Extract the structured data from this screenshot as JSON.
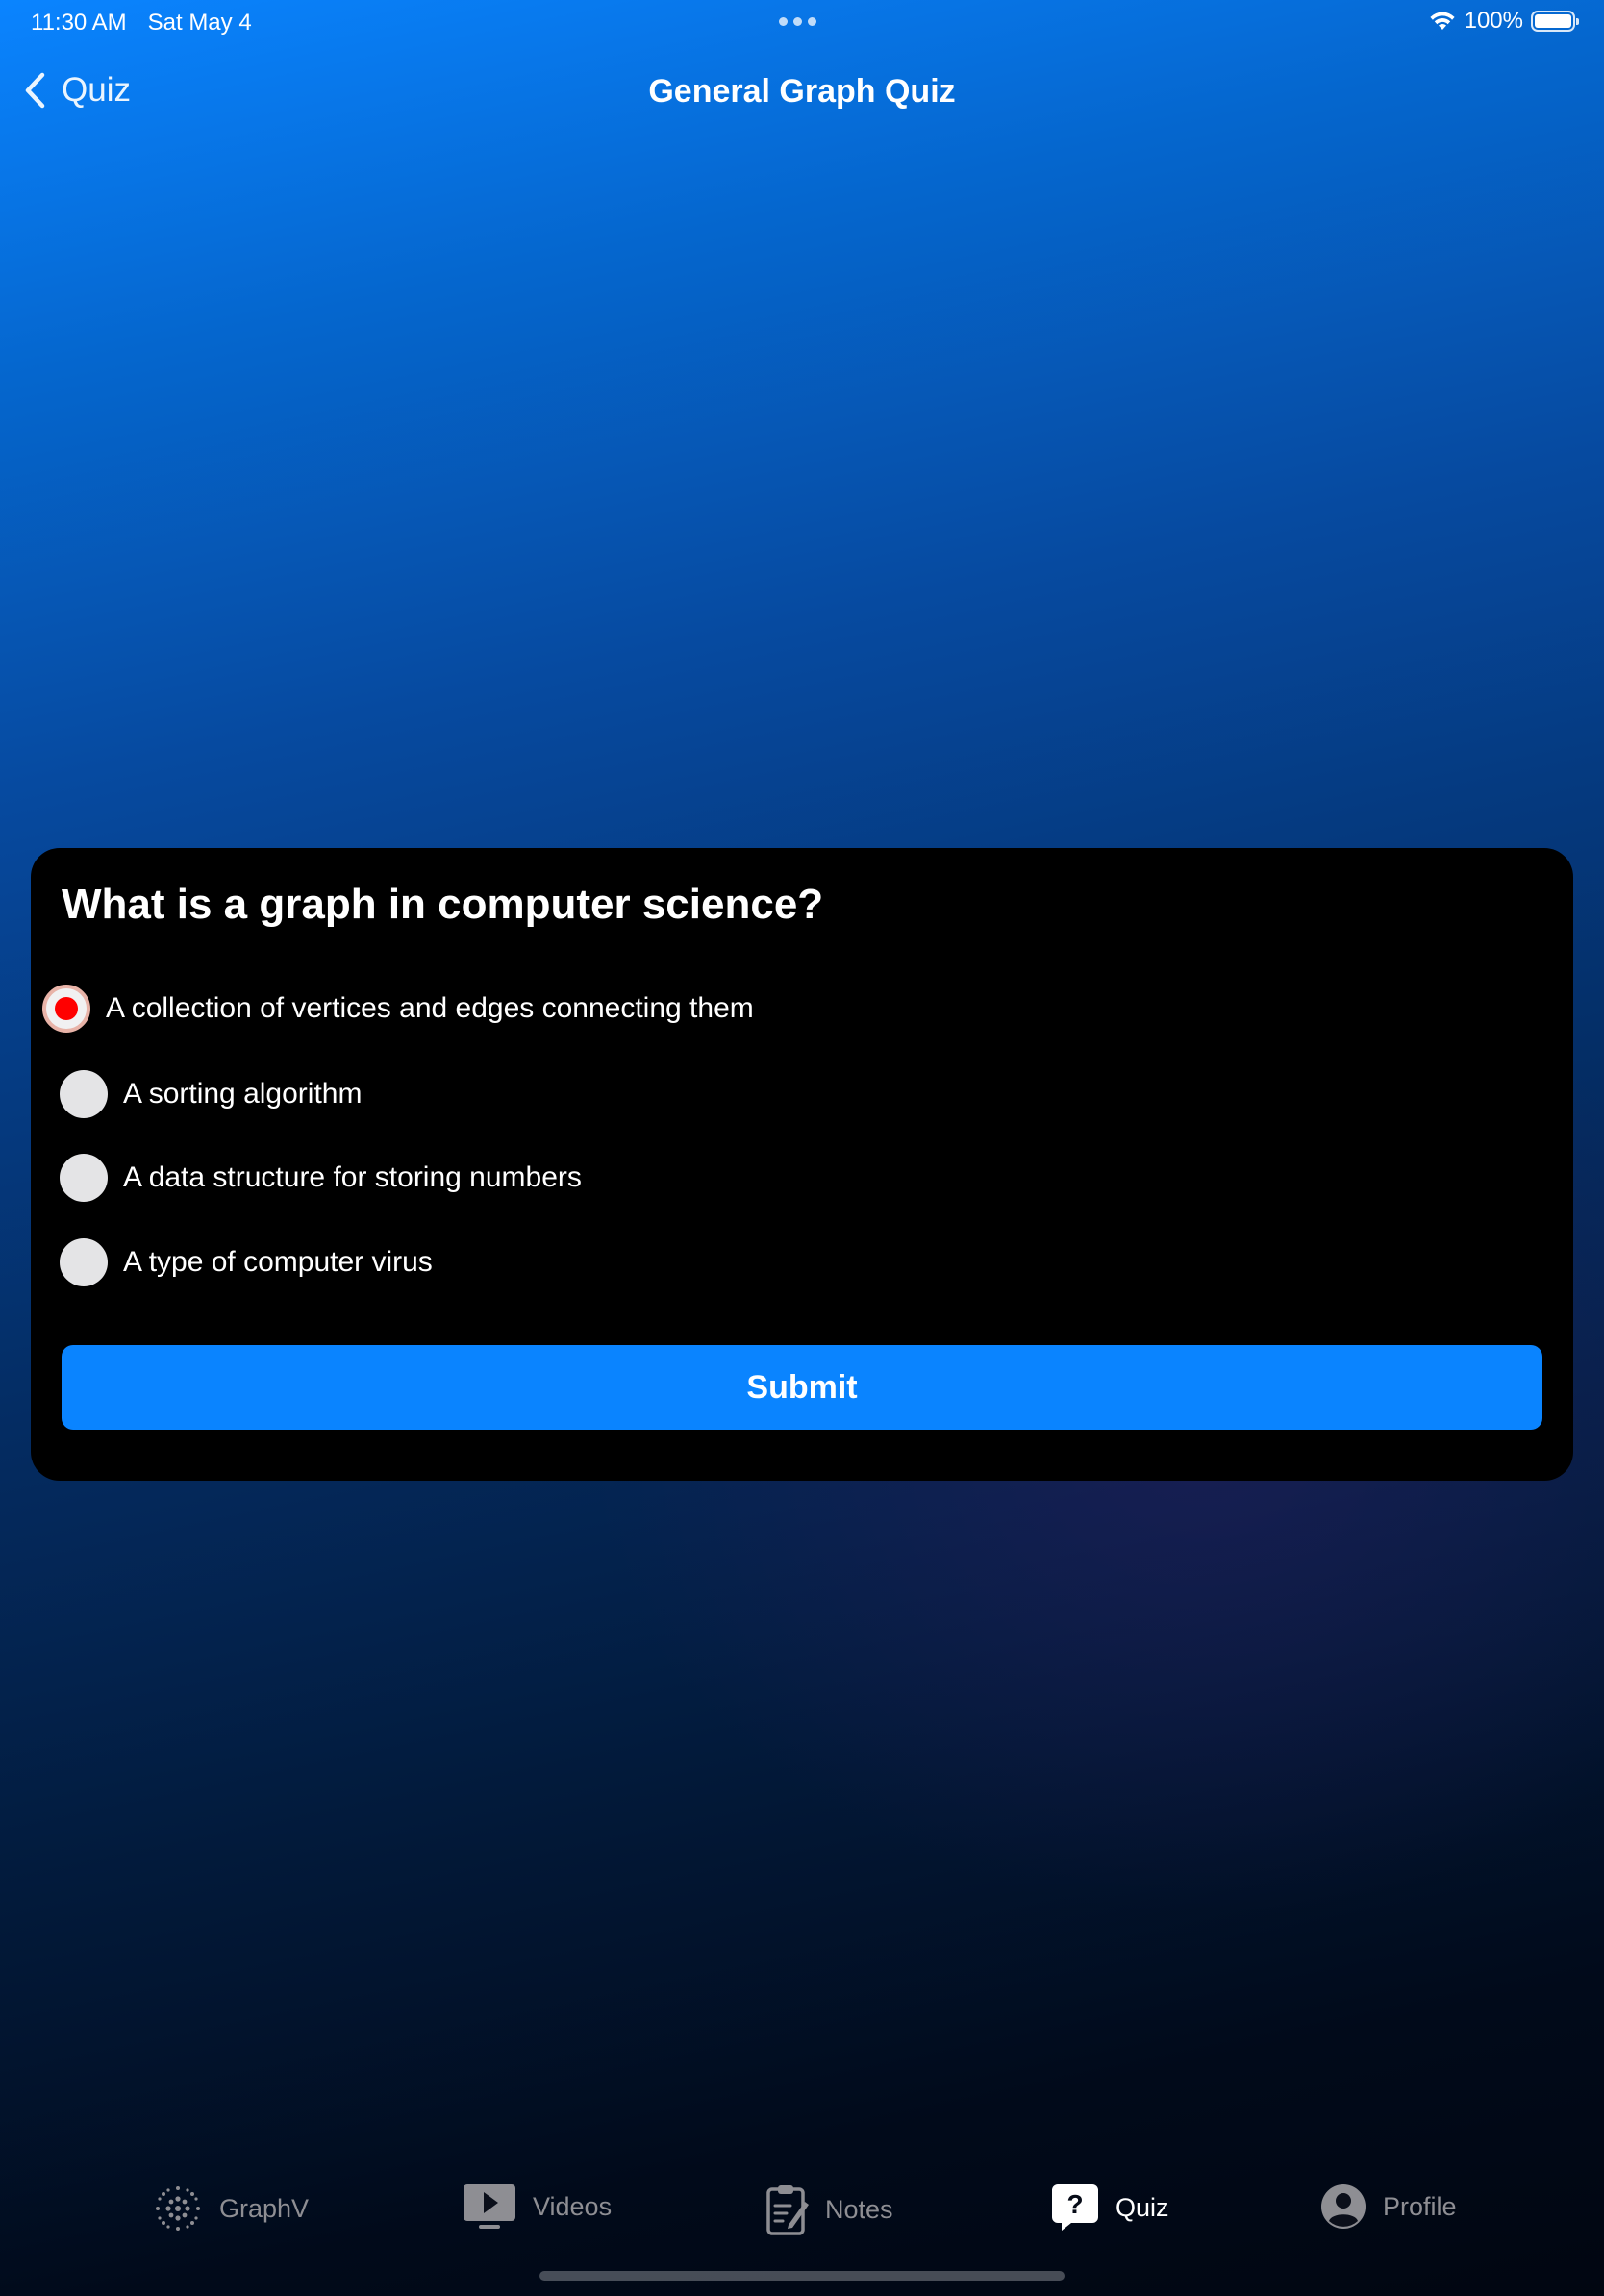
{
  "status_bar": {
    "time": "11:30 AM",
    "date": "Sat May 4",
    "battery": "100%",
    "battery_level": 1.0
  },
  "nav": {
    "back_label": "Quiz",
    "title": "General Graph Quiz"
  },
  "quiz": {
    "question": "What is a graph in computer science?",
    "options": [
      {
        "label": "A collection of vertices and edges connecting them",
        "selected": true
      },
      {
        "label": "A sorting algorithm",
        "selected": false
      },
      {
        "label": "A data structure for storing numbers",
        "selected": false
      },
      {
        "label": "A type of computer virus",
        "selected": false
      }
    ],
    "submit_label": "Submit"
  },
  "tab_bar": {
    "items": [
      {
        "label": "GraphV",
        "icon": "graph-dots-icon",
        "active": false
      },
      {
        "label": "Videos",
        "icon": "play-screen-icon",
        "active": false
      },
      {
        "label": "Notes",
        "icon": "clipboard-pencil-icon",
        "active": false
      },
      {
        "label": "Quiz",
        "icon": "question-bubble-icon",
        "active": true
      },
      {
        "label": "Profile",
        "icon": "person-circle-icon",
        "active": false
      }
    ]
  },
  "colors": {
    "accent": "#0a84ff",
    "selected_radio": "#ff0000",
    "card_background": "#000000",
    "inactive_tab": "#8e8e93"
  }
}
